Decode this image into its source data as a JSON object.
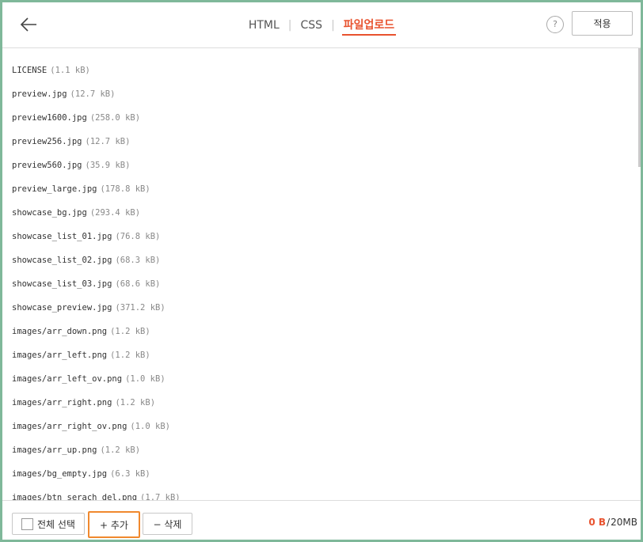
{
  "header": {
    "tabs": [
      "HTML",
      "CSS",
      "파일업로드"
    ],
    "active_tab": 2,
    "help_label": "?",
    "apply_label": "적용"
  },
  "files": [
    {
      "name": "LICENSE",
      "size": "(1.1 kB)"
    },
    {
      "name": "preview.jpg",
      "size": "(12.7 kB)"
    },
    {
      "name": "preview1600.jpg",
      "size": "(258.0 kB)"
    },
    {
      "name": "preview256.jpg",
      "size": "(12.7 kB)"
    },
    {
      "name": "preview560.jpg",
      "size": "(35.9 kB)"
    },
    {
      "name": "preview_large.jpg",
      "size": "(178.8 kB)"
    },
    {
      "name": "showcase_bg.jpg",
      "size": "(293.4 kB)"
    },
    {
      "name": "showcase_list_01.jpg",
      "size": "(76.8 kB)"
    },
    {
      "name": "showcase_list_02.jpg",
      "size": "(68.3 kB)"
    },
    {
      "name": "showcase_list_03.jpg",
      "size": "(68.6 kB)"
    },
    {
      "name": "showcase_preview.jpg",
      "size": "(371.2 kB)"
    },
    {
      "name": "images/arr_down.png",
      "size": "(1.2 kB)"
    },
    {
      "name": "images/arr_left.png",
      "size": "(1.2 kB)"
    },
    {
      "name": "images/arr_left_ov.png",
      "size": "(1.0 kB)"
    },
    {
      "name": "images/arr_right.png",
      "size": "(1.2 kB)"
    },
    {
      "name": "images/arr_right_ov.png",
      "size": "(1.0 kB)"
    },
    {
      "name": "images/arr_up.png",
      "size": "(1.2 kB)"
    },
    {
      "name": "images/bg_empty.jpg",
      "size": "(6.3 kB)"
    },
    {
      "name": "images/btn_serach_del.png",
      "size": "(1.7 kB)"
    }
  ],
  "footer": {
    "select_all_label": "전체 선택",
    "add_label": "+ 추가",
    "delete_label": "− 삭제",
    "used": "0 B",
    "limit": "20MB"
  },
  "colors": {
    "accent": "#e8522e",
    "frame": "#7fb89a",
    "add_highlight": "#f0892e"
  }
}
